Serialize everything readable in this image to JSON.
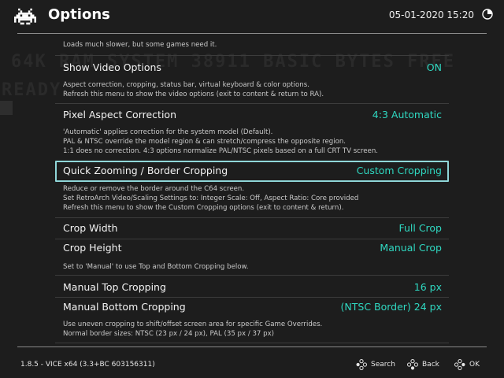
{
  "background_text": {
    "line1": "64K RAM SYSTEM  38911 BASIC BYTES FREE",
    "line2": "READY."
  },
  "header": {
    "title": "Options",
    "datetime": "05-01-2020 15:20",
    "logo_icon": "space-invader-icon",
    "battery_icon": "battery-icon"
  },
  "top_desc": "Loads much slower, but some games need it.",
  "items": [
    {
      "label": "Show Video Options",
      "value": "ON",
      "desc": "Aspect correction, cropping, status bar, virtual keyboard & color options.\nRefresh this menu to show the video options (exit to content & return to RA)."
    },
    {
      "label": "Pixel Aspect Correction",
      "value": "4:3 Automatic",
      "desc": "'Automatic' applies correction for the system model (Default).\nPAL & NTSC override the model region & can stretch/compress the opposite region.\n1:1 does no correction. 4:3 options normalize PAL/NTSC pixels based on a full CRT TV screen."
    },
    {
      "label": "Quick Zooming / Border Cropping",
      "value": "Custom Cropping",
      "selected": true,
      "desc": "Reduce or remove the border around the C64 screen.\nSet RetroArch Video/Scaling Settings to: Integer Scale: Off, Aspect Ratio: Core provided\nRefresh this menu to show the Custom Cropping options (exit to content & return)."
    },
    {
      "label": "Crop Width",
      "value": "Full Crop"
    },
    {
      "label": "Crop Height",
      "value": "Manual Crop",
      "desc": "Set to 'Manual' to use Top and Bottom Cropping below."
    },
    {
      "label": "Manual Top Cropping",
      "value": "16 px"
    },
    {
      "label": "Manual Bottom Cropping",
      "value": "(NTSC Border) 24 px",
      "desc": "Use uneven cropping to shift/offset screen area for specific Game Overrides.\nNormal border sizes: NTSC (23 px / 24 px), PAL (35 px / 37 px)"
    }
  ],
  "footer": {
    "version": "1.8.5 - VICE x64 (3.3+BC 603156311)",
    "search_label": "Search",
    "back_label": "Back",
    "ok_label": "OK"
  },
  "colors": {
    "background": "#1d1d1d",
    "value_accent": "#2fd8c1",
    "selection_border": "#8fd6d8"
  }
}
